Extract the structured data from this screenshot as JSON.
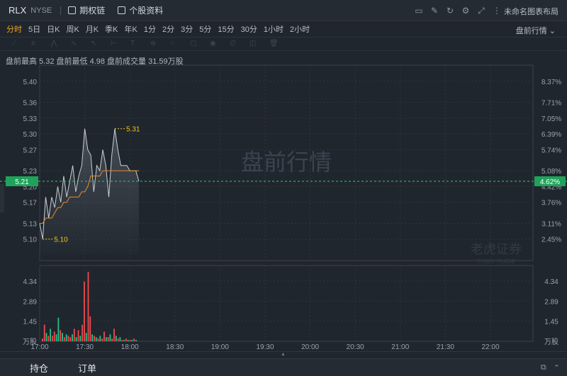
{
  "header": {
    "symbol": "RLX",
    "exchange": "NYSE",
    "options_label": "期权链",
    "profile_label": "个股资料",
    "layout_label": "未命名图表布局",
    "icons": [
      "screen-icon",
      "edit-icon",
      "refresh-icon",
      "settings-icon",
      "fullscreen-icon",
      "more-icon"
    ]
  },
  "periods": [
    "分时",
    "5日",
    "日K",
    "周K",
    "月K",
    "季K",
    "年K",
    "1分",
    "2分",
    "3分",
    "5分",
    "15分",
    "30分",
    "1小时",
    "2小时"
  ],
  "active_period": "分时",
  "session_select": "盘前行情",
  "info_line": "盘前最高 5.32  盘前最低 4.98  盘前成交量 31.59万股",
  "watermark": "盘前行情",
  "brand_watermark": "老虎证券",
  "brand_watermark_en": "TIGER TRADE",
  "price_axis": [
    "5.40",
    "5.36",
    "5.33",
    "5.30",
    "5.27",
    "5.23",
    "5.20",
    "5.17",
    "5.13",
    "5.10"
  ],
  "pct_axis": [
    "8.37%",
    "7.71%",
    "7.05%",
    "6.39%",
    "5.74%",
    "5.08%",
    "4.42%",
    "3.76%",
    "3.11%",
    "2.45%"
  ],
  "current_price": "5.21",
  "current_pct": "4.62%",
  "high_marker": "5.31",
  "low_marker": "5.10",
  "vol_axis": [
    "4.34",
    "2.89",
    "1.45"
  ],
  "vol_unit": "万股",
  "time_axis": [
    "17:00",
    "17:30",
    "18:00",
    "18:30",
    "19:00",
    "19:30",
    "20:00",
    "20:30",
    "21:00",
    "21:30",
    "22:00"
  ],
  "bottom_tabs": [
    "持仓",
    "订单"
  ],
  "colors": {
    "up": "#ef4a4a",
    "down": "#22c28a",
    "avg": "#e6902a",
    "price": "#c8cdd3",
    "current": "#2ecc71",
    "marker": "#f0c419"
  },
  "chart_data": {
    "type": "line",
    "x": [
      "17:00",
      "17:02",
      "17:04",
      "17:06",
      "17:08",
      "17:10",
      "17:12",
      "17:14",
      "17:16",
      "17:18",
      "17:20",
      "17:22",
      "17:24",
      "17:26",
      "17:28",
      "17:30",
      "17:32",
      "17:34",
      "17:36",
      "17:38",
      "17:40",
      "17:42",
      "17:44",
      "17:46",
      "17:48",
      "17:50",
      "17:52",
      "17:54",
      "17:56",
      "17:58",
      "18:00",
      "18:02",
      "18:04",
      "18:06"
    ],
    "series": [
      {
        "values": [
          5.13,
          5.1,
          5.18,
          5.14,
          5.18,
          5.16,
          5.2,
          5.17,
          5.22,
          5.18,
          5.21,
          5.24,
          5.19,
          5.22,
          5.24,
          5.31,
          5.27,
          5.26,
          5.19,
          5.24,
          5.23,
          5.27,
          5.24,
          5.18,
          5.26,
          5.31,
          5.27,
          5.24,
          5.24,
          5.24,
          5.23,
          5.23,
          5.23,
          5.21
        ]
      },
      {
        "values": [
          5.13,
          5.13,
          5.14,
          5.14,
          5.14,
          5.15,
          5.16,
          5.16,
          5.17,
          5.17,
          5.18,
          5.18,
          5.18,
          5.18,
          5.19,
          5.19,
          5.2,
          5.22,
          5.22,
          5.22,
          5.22,
          5.23,
          5.23,
          5.23,
          5.23,
          5.23,
          5.23,
          5.23,
          5.23,
          5.23,
          5.23,
          5.23,
          5.23,
          5.23
        ]
      }
    ],
    "volume": {
      "values": [
        0.2,
        1.2,
        0.6,
        0.4,
        0.9,
        0.4,
        0.7,
        0.5,
        1.7,
        0.8,
        0.6,
        0.3,
        0.5,
        0.4,
        0.3,
        0.5,
        0.9,
        0.3,
        0.8,
        0.4,
        1.2,
        4.3,
        0.6,
        5.0,
        1.8,
        0.5,
        0.4,
        0.3,
        0.2,
        0.4,
        0.2,
        0.7,
        0.3,
        0.3,
        0.5,
        0.2,
        0.9,
        0.4,
        0.2,
        0.3,
        0.1,
        0.1,
        0.2,
        0.1,
        0.1,
        0.1,
        0.2,
        0.1
      ],
      "up": [
        true,
        true,
        false,
        true,
        false,
        true,
        true,
        false,
        false,
        true,
        false,
        true,
        false,
        true,
        true,
        false,
        true,
        false,
        true,
        false,
        true,
        true,
        false,
        true,
        true,
        false,
        true,
        false,
        true,
        false,
        true,
        true,
        false,
        true,
        false,
        true,
        true,
        false,
        true,
        false,
        true,
        false,
        true,
        false,
        true,
        false,
        true,
        false
      ]
    },
    "ylim": [
      5.07,
      5.42
    ],
    "grid": true
  }
}
